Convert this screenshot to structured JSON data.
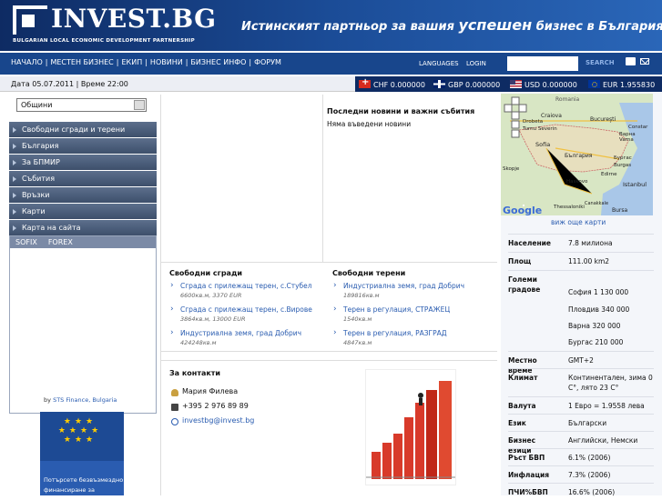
{
  "header": {
    "logo_text": "INVEST.BG",
    "logo_sub": "BULGARIAN LOCAL ECONOMIC DEVELOPMENT PARTNERSHIP",
    "tagline_pre": "Истинският партньор за вашия ",
    "tagline_em": "успешен",
    "tagline_post": " бизнес в България!"
  },
  "nav": {
    "items": [
      "НАЧАЛО",
      "МЕСТЕН БИЗНЕС",
      "ЕКИП",
      "НОВИНИ",
      "БИЗНЕС ИНФО",
      "ФОРУМ"
    ],
    "sep": "|",
    "languages": "LANGUAGES",
    "login": "LOGIN",
    "search_label": "SEARCH",
    "search_value": ""
  },
  "infobar": {
    "date_label": "Дата 05.07.2011 | Време 22:00",
    "rates": [
      {
        "flag": "ch",
        "text": "CHF 0.000000"
      },
      {
        "flag": "gb",
        "text": "GBP 0.000000"
      },
      {
        "flag": "us",
        "text": "USD 0.000000"
      },
      {
        "flag": "eu",
        "text": "EUR 1.955830"
      }
    ]
  },
  "sidebar": {
    "select_value": "Общини",
    "items": [
      "Свободни сгради и терени",
      "България",
      "За БПМИР",
      "Събития",
      "Връзки",
      "Карти",
      "Карта на сайта"
    ],
    "tabs": [
      "SOFIX",
      "FOREX"
    ],
    "by_text": "by",
    "by_link": "STS Finance, Bulgaria",
    "banner_text_1": "Потърсете безвъзмездно",
    "banner_text_2": "финансиране за"
  },
  "news": {
    "title": "Последни новини и важни събития",
    "empty": "Няма въведени новини"
  },
  "buildings": {
    "title": "Свободни сгради",
    "items": [
      {
        "name": "Сграда с прилежащ терен, с.Стубел",
        "info": "6600кв.м, 3370 EUR"
      },
      {
        "name": "Сграда с прилежащ терен, с.Вирове",
        "info": "3864кв.м, 13000 EUR"
      },
      {
        "name": "Индустриална земя, град Добрич",
        "info": "424248кв.м"
      }
    ]
  },
  "terrains": {
    "title": "Свободни терени",
    "items": [
      {
        "name": "Индустриална земя, град Добрич",
        "info": "189816кв.м"
      },
      {
        "name": "Терен в регулация, СТРАЖЕЦ",
        "info": "1540кв.м"
      },
      {
        "name": "Терен в регулация, РАЗГРАД",
        "info": "4847кв.м"
      }
    ]
  },
  "contacts": {
    "title": "За контакти",
    "name": "Мария Филева",
    "phone": "+395 2 976 89 89",
    "email": "investbg@invest.bg"
  },
  "map": {
    "labels": [
      "Romania",
      "Craiova",
      "Bucureşti",
      "Drobeta",
      "Turnu Severin",
      "Constar",
      "Sofia",
      "Варна",
      "Varna",
      "България",
      "Бургас",
      "Burgas",
      "Edirne",
      "Istanbul",
      "Haskovo",
      "Skopje",
      "Thessaloniki",
      "Canakkale",
      "Bursa"
    ],
    "see_maps": "виж още карти",
    "logo": "Google"
  },
  "facts": [
    {
      "k": "Население",
      "v": "7.8 милиона"
    },
    {
      "k": "Площ",
      "v": "111.00 km2"
    },
    {
      "k": "Големи градове",
      "v": "София 1 130 000"
    },
    {
      "k": "",
      "v": "Пловдив 340 000"
    },
    {
      "k": "",
      "v": "Варна 320 000"
    },
    {
      "k": "",
      "v": "Бургас 210 000"
    },
    {
      "k": "Местно време",
      "v": "GMT+2"
    },
    {
      "k": "Климат",
      "v": "Континентален, зима 0 C°, лято 23 C°"
    },
    {
      "k": "Валута",
      "v": "1 Евро = 1.9558 лева"
    },
    {
      "k": "Език",
      "v": "Български"
    },
    {
      "k": "Бизнес езици",
      "v": "Английски, Немски"
    },
    {
      "k": "Ръст БВП",
      "v": "6.1% (2006)"
    },
    {
      "k": "Инфлация",
      "v": "7.3% (2006)"
    },
    {
      "k": "ПЧИ%БВП",
      "v": "16.6% (2006)"
    }
  ],
  "colors": {
    "header_dark": "#0e2b63",
    "nav": "#18468c",
    "link": "#2a5cb0",
    "menu": "#4a5c78"
  }
}
